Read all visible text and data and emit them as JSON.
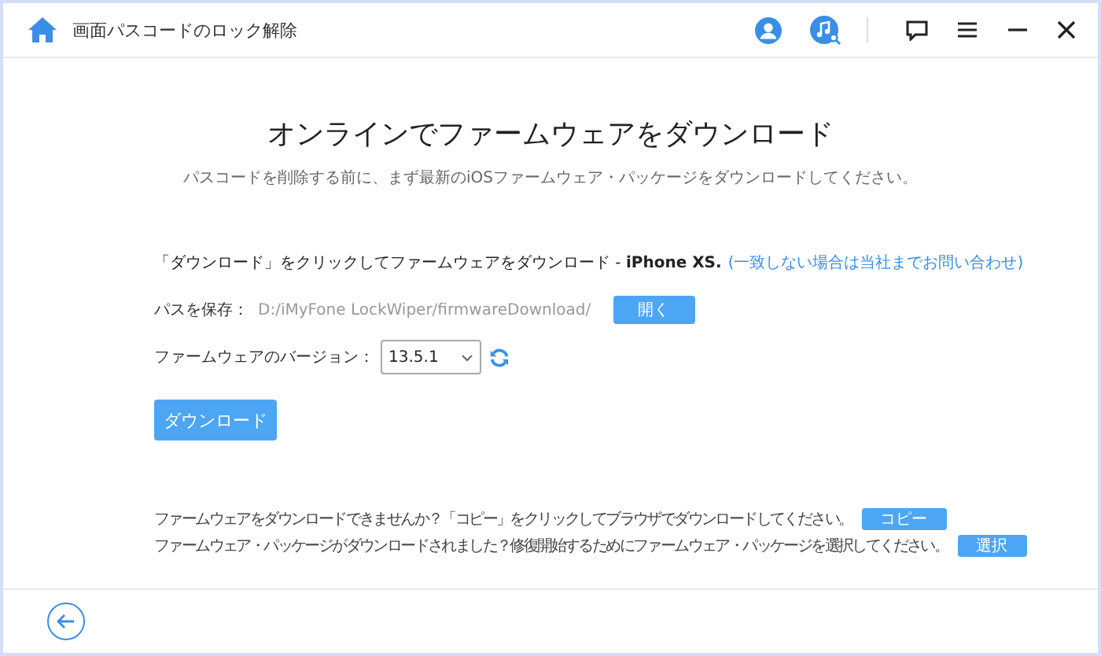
{
  "window": {
    "title": "画面パスコードのロック解除"
  },
  "heading": "オンラインでファームウェアをダウンロード",
  "subheading": "パスコードを削除する前に、まず最新のiOSファームウェア・パッケージをダウンロードしてください。",
  "instruction": {
    "text": "「ダウンロード」をクリックしてファームウェアをダウンロード - **iPhone XS.**",
    "link": "(一致しない場合は当社までお問い合わせ)"
  },
  "save_path": {
    "label": "パスを保存：",
    "value": "D:/iMyFone LockWiper/firmwareDownload/",
    "button": "開く"
  },
  "firmware_version": {
    "label": "ファームウェアのバージョン：",
    "value": "13.5.1"
  },
  "download_button": "ダウンロード",
  "help_lines": [
    {
      "text": "ファームウェアをダウンロードできませんか？「コピー」をクリックしてブラウザでダウンロードしてください。",
      "button": "コピー"
    },
    {
      "text": "ファームウェア・パッケージがダウンロードされました？修復開始するためにファームウェア・パッケージを選択してください。",
      "button": "選択"
    }
  ]
}
